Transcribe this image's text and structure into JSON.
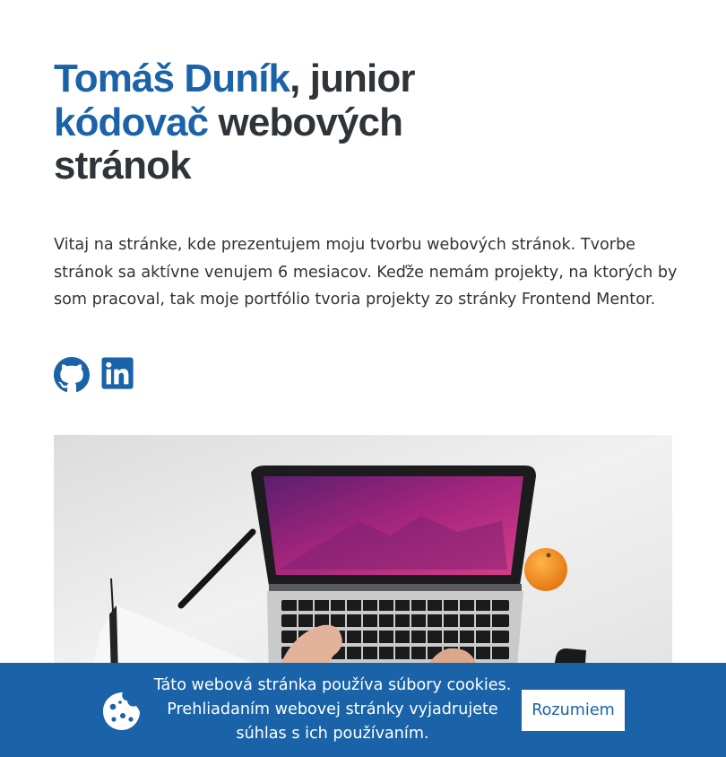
{
  "hero": {
    "name": "Tomáš Duník",
    "after_name": ", junior ",
    "role": "kódovač",
    "after_role": " webových stránok"
  },
  "intro": {
    "text": "Vitaj na stránke, kde prezentujem moju tvorbu webových stránok. Tvorbe stránok sa aktívne venujem 6 mesiacov. Keďže nemám projekty, na ktorých by som pracoval, tak moje portfólio tvoria projekty zo stránky Frontend Mentor."
  },
  "social": {
    "icons": [
      "github-icon",
      "linkedin-icon"
    ]
  },
  "cookie": {
    "text": "Táto webová stránka používa súbory cookies. Prehliadaním webovej stránky vyjadrujete súhlas s ich používaním.",
    "button_label": "Rozumiem",
    "icon": "cookie-icon"
  },
  "colors": {
    "accent": "#1a63a8",
    "text": "#2f3439",
    "background": "#ffffff"
  }
}
